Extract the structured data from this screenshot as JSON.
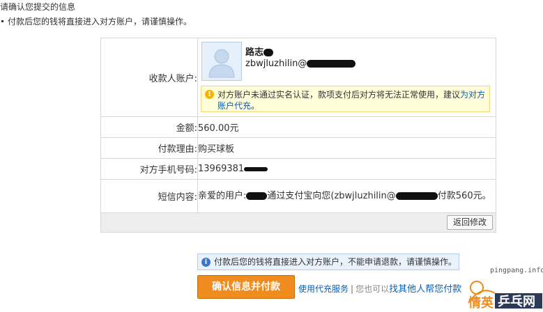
{
  "header": {
    "title": "请确认您提交的信息",
    "note": "付款后您的钱将直接进入对方账户，请谨慎操作。"
  },
  "form": {
    "payee_label": "收款人账户:",
    "payee_name": "路志",
    "payee_email": "zbwjluzhilin@",
    "warning_text": "对方账户未通过实名认证，款项支付后对方将无法正常使用，建议",
    "warning_link": "为对方账户代充",
    "warning_end": "。",
    "amount_label": "金额:",
    "amount_value": "560.00元",
    "reason_label": "付款理由:",
    "reason_value": "购买球板",
    "phone_label": "对方手机号码:",
    "phone_value": "13969381",
    "sms_label": "短信内容:",
    "sms_value_start": "亲爱的用户:",
    "sms_value_mid": "通过支付宝向您(zbwjluzhilin@",
    "sms_value_end": "付款560元。",
    "back_button": "返回修改"
  },
  "info_bar": {
    "text": "付款后您的钱将直接进入对方账户，不能申请退款，请谨慎操作。"
  },
  "actions": {
    "confirm_button": "确认信息并付款",
    "agent_link": "使用代充服务",
    "separator": "|",
    "alt_text": "您也可以",
    "alt_link": "找其他人帮您付款"
  },
  "watermark": {
    "url": "pingpang.info",
    "logo_text": "乒乓网",
    "logo_prefix": "情英"
  },
  "colors": {
    "accent_orange": "#f08c1e",
    "link_blue": "#0a5fb4",
    "warning_bg": "#fffcd8",
    "info_bg": "#e9f1fb"
  }
}
